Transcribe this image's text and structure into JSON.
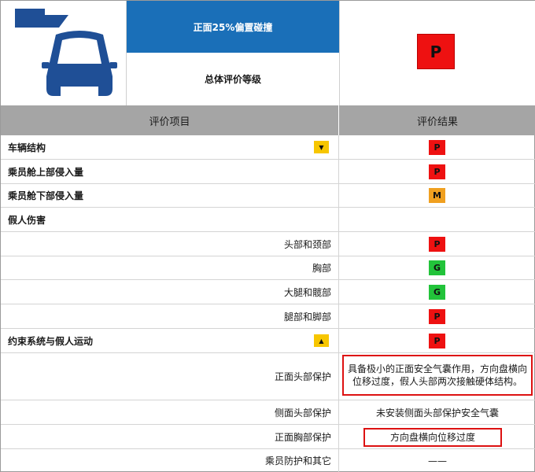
{
  "header": {
    "test_title": "正面25%偏置碰撞",
    "overall_label": "总体评价等级",
    "overall_rating": "P",
    "icon": "car-front-collision-icon"
  },
  "columns": {
    "item": "评价项目",
    "result": "评价结果"
  },
  "rows": [
    {
      "item": "车辆结构",
      "type": "category",
      "toggle": "▼",
      "rating": "P"
    },
    {
      "item": "乘员舱上部侵入量",
      "type": "category",
      "rating": "P"
    },
    {
      "item": "乘员舱下部侵入量",
      "type": "category",
      "rating": "M"
    },
    {
      "item": "假人伤害",
      "type": "category",
      "rating": ""
    },
    {
      "item": "头部和颈部",
      "type": "sub",
      "rating": "P"
    },
    {
      "item": "胸部",
      "type": "sub",
      "rating": "G"
    },
    {
      "item": "大腿和髋部",
      "type": "sub",
      "rating": "G"
    },
    {
      "item": "腿部和脚部",
      "type": "sub",
      "rating": "P"
    },
    {
      "item": "约束系统与假人运动",
      "type": "category",
      "toggle": "▲",
      "rating": "P"
    },
    {
      "item": "正面头部保护",
      "type": "sub",
      "note": "具备极小的正面安全气囊作用，方向盘横向位移过度，假人头部两次接触硬体结构。"
    },
    {
      "item": "侧面头部保护",
      "type": "sub",
      "note": "未安装侧面头部保护安全气囊"
    },
    {
      "item": "正面胸部保护",
      "type": "sub",
      "note": "方向盘横向位移过度"
    },
    {
      "item": "乘员防护和其它",
      "type": "sub",
      "note": "——"
    }
  ],
  "colors": {
    "header_blue": "#1a6fb8",
    "poor": "#ee1111",
    "marginal": "#f0a020",
    "good": "#22c33a",
    "toggle": "#f7c600"
  }
}
